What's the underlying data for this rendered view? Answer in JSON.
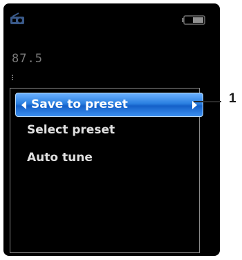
{
  "status_bar": {
    "left_icon": "radio-icon",
    "right_icon": "battery-icon"
  },
  "tuner": {
    "frequency": "87.5"
  },
  "menu": {
    "items": [
      {
        "label": "Save to preset",
        "selected": true
      },
      {
        "label": "Select preset",
        "selected": false
      },
      {
        "label": "Auto tune",
        "selected": false
      }
    ]
  },
  "callout": {
    "number": "1"
  },
  "colors": {
    "highlight": "#2a7fe0",
    "text": "#e0e0e0",
    "background": "#000000"
  }
}
